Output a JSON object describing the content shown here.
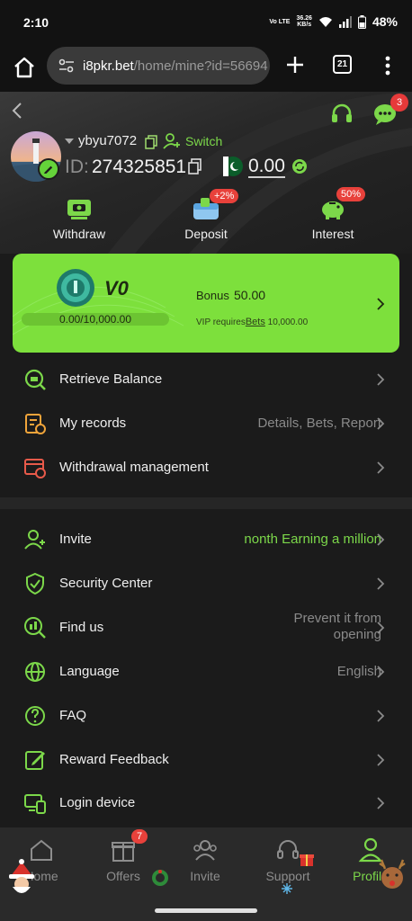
{
  "status_bar": {
    "time": "2:10",
    "network": "Vo LTE",
    "speed_value": "36.26",
    "speed_unit": "KB/s",
    "battery": "48%"
  },
  "browser": {
    "url_host": "i8pkr.bet",
    "url_path": "/home/mine?id=56694",
    "tab_count": "21"
  },
  "header": {
    "support_badge": "3",
    "username": "ybyu7072",
    "switch_label": "Switch",
    "id_label": "ID:",
    "id_value": "274325851",
    "balance": "0.00"
  },
  "actions": [
    {
      "label": "Withdraw",
      "icon": "withdraw-icon"
    },
    {
      "label": "Deposit",
      "icon": "deposit-icon",
      "badge": "+2%"
    },
    {
      "label": "Interest",
      "icon": "piggy-bank-icon",
      "badge": "50%"
    }
  ],
  "vip": {
    "level": "V0",
    "progress_text": "0.00/10,000.00",
    "bonus_label": "Bonus",
    "bonus_value": "50.00",
    "requires_prefix": "VIP requires",
    "requires_link": "Bets",
    "requires_value": "10,000.00"
  },
  "menu_top": [
    {
      "label": "Retrieve Balance",
      "icon": "retrieve-balance-icon",
      "value": ""
    },
    {
      "label": "My records",
      "icon": "records-icon",
      "value": "Details, Bets, Report"
    },
    {
      "label": "Withdrawal management",
      "icon": "withdrawal-management-icon",
      "value": ""
    }
  ],
  "menu_bottom": [
    {
      "label": "Invite",
      "icon": "invite-icon",
      "value": "nonth  Earning a million"
    },
    {
      "label": "Security Center",
      "icon": "shield-icon",
      "value": ""
    },
    {
      "label": "Find us",
      "icon": "find-us-icon",
      "value_line1": "Prevent it from",
      "value_line2": "opening"
    },
    {
      "label": "Language",
      "icon": "globe-icon",
      "value": "English"
    },
    {
      "label": "FAQ",
      "icon": "question-icon",
      "value": ""
    },
    {
      "label": "Reward Feedback",
      "icon": "feedback-icon",
      "value": ""
    },
    {
      "label": "Login device",
      "icon": "devices-icon",
      "value": ""
    }
  ],
  "bottom_nav": {
    "offers_badge": "7",
    "items": [
      {
        "label": "Home",
        "icon": "home-icon"
      },
      {
        "label": "Offers",
        "icon": "gift-icon"
      },
      {
        "label": "Invite",
        "icon": "invite-people-icon"
      },
      {
        "label": "Support",
        "icon": "headset-icon"
      },
      {
        "label": "Profile",
        "icon": "profile-icon"
      }
    ]
  },
  "colors": {
    "accent": "#7de03c",
    "background": "#1b1b1b",
    "badge": "#e8413b"
  }
}
